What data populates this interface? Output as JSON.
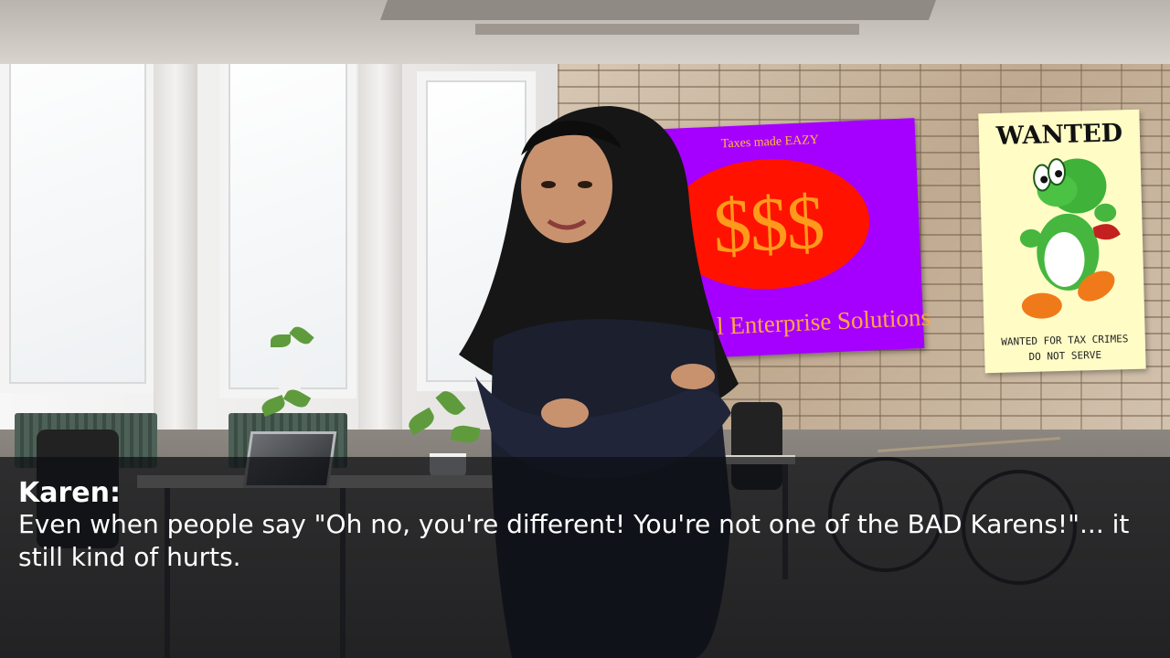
{
  "scene": {
    "background": "office",
    "posters": {
      "taxes": {
        "tagline": "Taxes made EAZY",
        "symbol": "$$$",
        "company": "l Enterprise Solutions",
        "colors": {
          "background": "#a500ff",
          "ellipse": "#ff1200",
          "text": "#ffa640"
        }
      },
      "wanted": {
        "title": "WANTED",
        "caption_line1": "WANTED FOR TAX CRIMES",
        "caption_line2": "DO NOT SERVE",
        "image_icon": "yoshi-icon",
        "colors": {
          "background": "#fffcc6"
        }
      }
    }
  },
  "dialogue": {
    "speaker": "Karen:",
    "text": "Even when people say \"Oh no, you're different! You're not one of the BAD Karens!\"... it still kind of hurts."
  }
}
